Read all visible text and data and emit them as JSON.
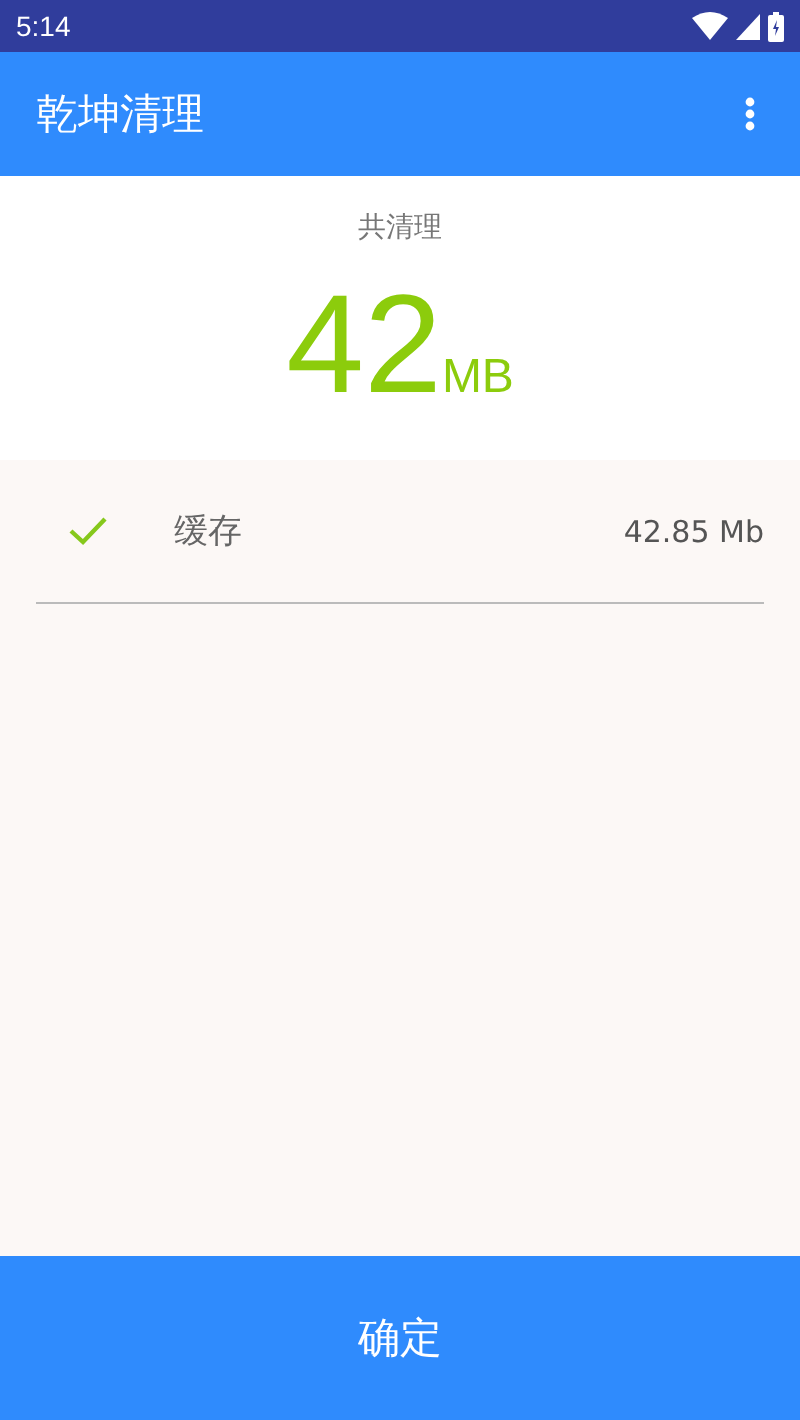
{
  "status_bar": {
    "time": "5:14"
  },
  "app_bar": {
    "title": "乾坤清理"
  },
  "summary": {
    "label": "共清理",
    "amount": "42",
    "unit": "MB"
  },
  "items": [
    {
      "name": "缓存",
      "size": "42.85 Mb",
      "checked": true
    }
  ],
  "confirm_button": {
    "label": "确定"
  }
}
